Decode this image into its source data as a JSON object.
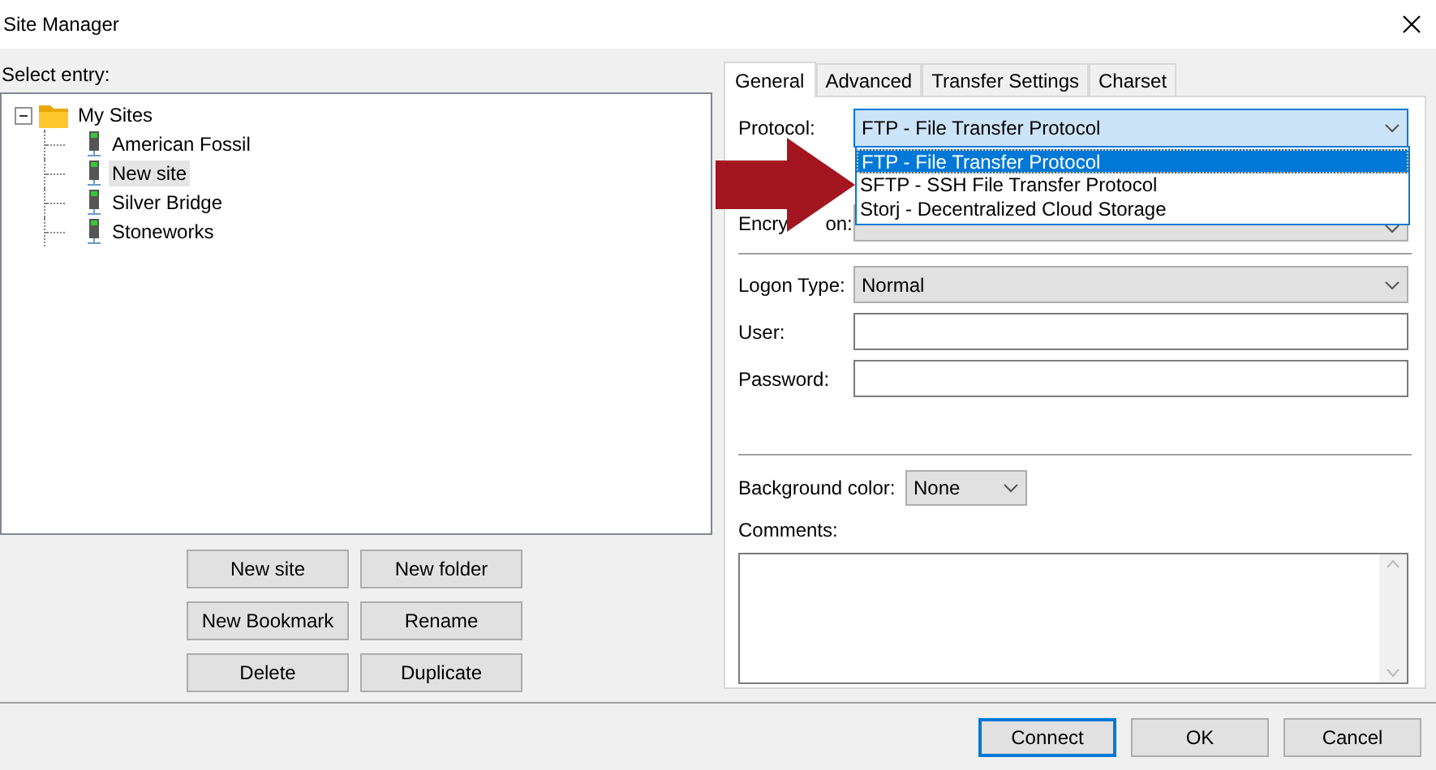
{
  "window": {
    "title": "Site Manager"
  },
  "select_entry_label": "Select entry:",
  "tree": [
    {
      "label": "My Sites",
      "kind": "folder",
      "expanded": true,
      "selected": false,
      "children": [
        {
          "label": "American Fossil",
          "kind": "site",
          "selected": false
        },
        {
          "label": "New site",
          "kind": "site",
          "selected": true
        },
        {
          "label": "Silver Bridge",
          "kind": "site",
          "selected": false
        },
        {
          "label": "Stoneworks",
          "kind": "site",
          "selected": false
        }
      ]
    }
  ],
  "tree_buttons": [
    "New site",
    "New folder",
    "New Bookmark",
    "Rename",
    "Delete",
    "Duplicate"
  ],
  "tabs": [
    {
      "label": "General",
      "selected": true
    },
    {
      "label": "Advanced",
      "selected": false
    },
    {
      "label": "Transfer Settings",
      "selected": false
    },
    {
      "label": "Charset",
      "selected": false
    }
  ],
  "protocol": {
    "label": "Protocol:",
    "value": "FTP - File Transfer Protocol",
    "options": [
      {
        "label": "FTP - File Transfer Protocol",
        "selected": true
      },
      {
        "label": "SFTP - SSH File Transfer Protocol",
        "selected": false
      },
      {
        "label": "Storj - Decentralized Cloud Storage",
        "selected": false
      }
    ]
  },
  "encryption": {
    "label_parts": [
      "Encry",
      "on:"
    ]
  },
  "logon_type": {
    "label": "Logon Type:",
    "value": "Normal"
  },
  "user": {
    "label": "User:"
  },
  "password": {
    "label": "Password:"
  },
  "background_color": {
    "label": "Background color:",
    "value": "None"
  },
  "comments": {
    "label": "Comments:"
  },
  "dialog_buttons": [
    {
      "label": "Connect",
      "default": true
    },
    {
      "label": "OK",
      "default": false
    },
    {
      "label": "Cancel",
      "default": false
    }
  ]
}
